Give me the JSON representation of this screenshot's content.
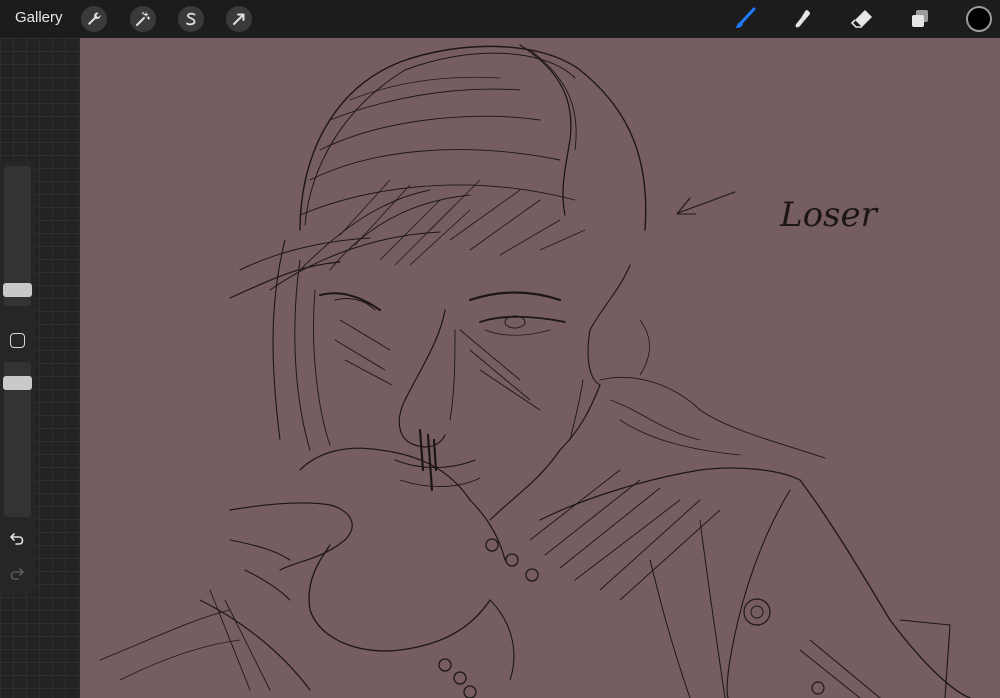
{
  "topbar": {
    "gallery_label": "Gallery",
    "left_tools": [
      {
        "name": "actions",
        "icon": "wrench-icon"
      },
      {
        "name": "adjustments",
        "icon": "magic-wand-icon"
      },
      {
        "name": "selection",
        "icon": "selection-s-icon"
      },
      {
        "name": "transform",
        "icon": "transform-arrow-icon"
      }
    ],
    "right_tools": [
      {
        "name": "brush",
        "icon": "brush-icon",
        "active": true
      },
      {
        "name": "smudge",
        "icon": "smudge-icon",
        "active": false
      },
      {
        "name": "eraser",
        "icon": "eraser-icon",
        "active": false
      },
      {
        "name": "layers",
        "icon": "layers-icon",
        "active": false
      }
    ],
    "current_color": "#000000",
    "active_color": "#1e7bff"
  },
  "sidebar": {
    "brush_size_level": 0.12,
    "opacity_level": 0.95,
    "undo_icon": "undo-icon",
    "redo_icon": "redo-icon"
  },
  "canvas": {
    "background_color": "#765e60",
    "handwritten_text": "Loser"
  }
}
